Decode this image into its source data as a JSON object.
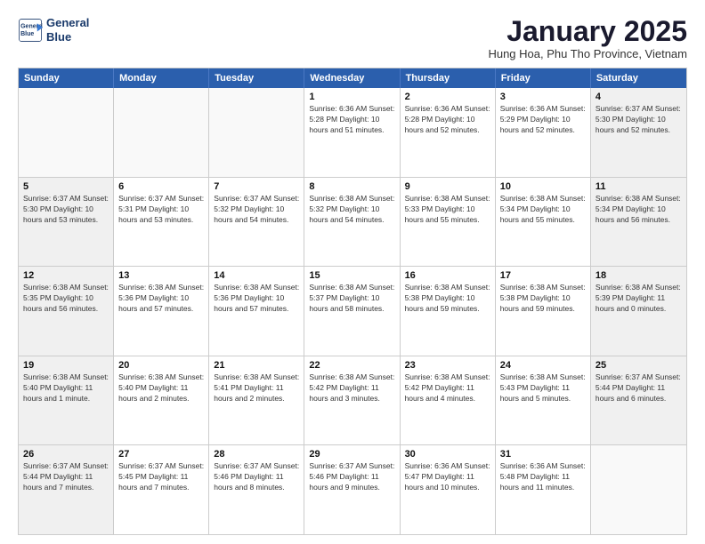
{
  "logo": {
    "line1": "General",
    "line2": "Blue"
  },
  "title": "January 2025",
  "subtitle": "Hung Hoa, Phu Tho Province, Vietnam",
  "headers": [
    "Sunday",
    "Monday",
    "Tuesday",
    "Wednesday",
    "Thursday",
    "Friday",
    "Saturday"
  ],
  "weeks": [
    [
      {
        "day": "",
        "info": "",
        "empty": true
      },
      {
        "day": "",
        "info": "",
        "empty": true
      },
      {
        "day": "",
        "info": "",
        "empty": true
      },
      {
        "day": "1",
        "info": "Sunrise: 6:36 AM\nSunset: 5:28 PM\nDaylight: 10 hours\nand 51 minutes."
      },
      {
        "day": "2",
        "info": "Sunrise: 6:36 AM\nSunset: 5:28 PM\nDaylight: 10 hours\nand 52 minutes."
      },
      {
        "day": "3",
        "info": "Sunrise: 6:36 AM\nSunset: 5:29 PM\nDaylight: 10 hours\nand 52 minutes."
      },
      {
        "day": "4",
        "info": "Sunrise: 6:37 AM\nSunset: 5:30 PM\nDaylight: 10 hours\nand 52 minutes."
      }
    ],
    [
      {
        "day": "5",
        "info": "Sunrise: 6:37 AM\nSunset: 5:30 PM\nDaylight: 10 hours\nand 53 minutes."
      },
      {
        "day": "6",
        "info": "Sunrise: 6:37 AM\nSunset: 5:31 PM\nDaylight: 10 hours\nand 53 minutes."
      },
      {
        "day": "7",
        "info": "Sunrise: 6:37 AM\nSunset: 5:32 PM\nDaylight: 10 hours\nand 54 minutes."
      },
      {
        "day": "8",
        "info": "Sunrise: 6:38 AM\nSunset: 5:32 PM\nDaylight: 10 hours\nand 54 minutes."
      },
      {
        "day": "9",
        "info": "Sunrise: 6:38 AM\nSunset: 5:33 PM\nDaylight: 10 hours\nand 55 minutes."
      },
      {
        "day": "10",
        "info": "Sunrise: 6:38 AM\nSunset: 5:34 PM\nDaylight: 10 hours\nand 55 minutes."
      },
      {
        "day": "11",
        "info": "Sunrise: 6:38 AM\nSunset: 5:34 PM\nDaylight: 10 hours\nand 56 minutes."
      }
    ],
    [
      {
        "day": "12",
        "info": "Sunrise: 6:38 AM\nSunset: 5:35 PM\nDaylight: 10 hours\nand 56 minutes."
      },
      {
        "day": "13",
        "info": "Sunrise: 6:38 AM\nSunset: 5:36 PM\nDaylight: 10 hours\nand 57 minutes."
      },
      {
        "day": "14",
        "info": "Sunrise: 6:38 AM\nSunset: 5:36 PM\nDaylight: 10 hours\nand 57 minutes."
      },
      {
        "day": "15",
        "info": "Sunrise: 6:38 AM\nSunset: 5:37 PM\nDaylight: 10 hours\nand 58 minutes."
      },
      {
        "day": "16",
        "info": "Sunrise: 6:38 AM\nSunset: 5:38 PM\nDaylight: 10 hours\nand 59 minutes."
      },
      {
        "day": "17",
        "info": "Sunrise: 6:38 AM\nSunset: 5:38 PM\nDaylight: 10 hours\nand 59 minutes."
      },
      {
        "day": "18",
        "info": "Sunrise: 6:38 AM\nSunset: 5:39 PM\nDaylight: 11 hours\nand 0 minutes."
      }
    ],
    [
      {
        "day": "19",
        "info": "Sunrise: 6:38 AM\nSunset: 5:40 PM\nDaylight: 11 hours\nand 1 minute."
      },
      {
        "day": "20",
        "info": "Sunrise: 6:38 AM\nSunset: 5:40 PM\nDaylight: 11 hours\nand 2 minutes."
      },
      {
        "day": "21",
        "info": "Sunrise: 6:38 AM\nSunset: 5:41 PM\nDaylight: 11 hours\nand 2 minutes."
      },
      {
        "day": "22",
        "info": "Sunrise: 6:38 AM\nSunset: 5:42 PM\nDaylight: 11 hours\nand 3 minutes."
      },
      {
        "day": "23",
        "info": "Sunrise: 6:38 AM\nSunset: 5:42 PM\nDaylight: 11 hours\nand 4 minutes."
      },
      {
        "day": "24",
        "info": "Sunrise: 6:38 AM\nSunset: 5:43 PM\nDaylight: 11 hours\nand 5 minutes."
      },
      {
        "day": "25",
        "info": "Sunrise: 6:37 AM\nSunset: 5:44 PM\nDaylight: 11 hours\nand 6 minutes."
      }
    ],
    [
      {
        "day": "26",
        "info": "Sunrise: 6:37 AM\nSunset: 5:44 PM\nDaylight: 11 hours\nand 7 minutes."
      },
      {
        "day": "27",
        "info": "Sunrise: 6:37 AM\nSunset: 5:45 PM\nDaylight: 11 hours\nand 7 minutes."
      },
      {
        "day": "28",
        "info": "Sunrise: 6:37 AM\nSunset: 5:46 PM\nDaylight: 11 hours\nand 8 minutes."
      },
      {
        "day": "29",
        "info": "Sunrise: 6:37 AM\nSunset: 5:46 PM\nDaylight: 11 hours\nand 9 minutes."
      },
      {
        "day": "30",
        "info": "Sunrise: 6:36 AM\nSunset: 5:47 PM\nDaylight: 11 hours\nand 10 minutes."
      },
      {
        "day": "31",
        "info": "Sunrise: 6:36 AM\nSunset: 5:48 PM\nDaylight: 11 hours\nand 11 minutes."
      },
      {
        "day": "",
        "info": "",
        "empty": true
      }
    ]
  ]
}
